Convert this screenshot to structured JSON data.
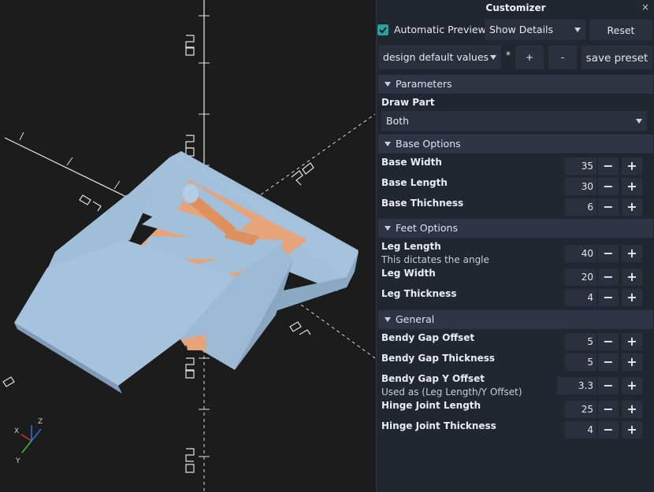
{
  "customizer": {
    "title": "Customizer",
    "close_label": "×",
    "automatic_preview_label": "Automatic Preview",
    "automatic_preview_checked": true,
    "details_select": "Show Details",
    "reset_label": "Reset",
    "preset_select": "design default values",
    "preset_modified_marker": "*",
    "add_preset_label": "+",
    "remove_preset_label": "-",
    "save_preset_label": "save preset"
  },
  "sections": {
    "parameters": {
      "label": "Parameters",
      "draw_part_label": "Draw Part",
      "draw_part_value": "Both"
    },
    "base_options": {
      "label": "Base Options",
      "base_width": {
        "label": "Base Width",
        "value": "35"
      },
      "base_length": {
        "label": "Base Length",
        "value": "30"
      },
      "base_thickness": {
        "label": "Base Thichness",
        "value": "6"
      }
    },
    "feet_options": {
      "label": "Feet Options",
      "leg_length": {
        "label": "Leg Length",
        "desc": "This dictates the angle",
        "value": "40"
      },
      "leg_width": {
        "label": "Leg Width",
        "value": "20"
      },
      "leg_thickness": {
        "label": "Leg Thickness",
        "value": "4"
      }
    },
    "general": {
      "label": "General",
      "bendy_gap_offset": {
        "label": "Bendy Gap Offset",
        "value": "5"
      },
      "bendy_gap_thickness": {
        "label": "Bendy Gap Thickness",
        "value": "5"
      },
      "bendy_gap_y_offset": {
        "label": "Bendy Gap Y Offset",
        "desc": "Used as (Leg Length/Y Offset)",
        "value": "3.3"
      },
      "hinge_joint_length": {
        "label": "Hinge Joint Length",
        "value": "25"
      },
      "hinge_joint_thickness": {
        "label": "Hinge Joint Thickness",
        "value": "4"
      }
    }
  },
  "stepper": {
    "minus": "−",
    "plus": "+"
  },
  "viewport": {
    "axis_labels": {
      "x": "X",
      "y": "Y",
      "z": "Z"
    },
    "colors": {
      "background": "#1c1c1c",
      "model_face": "#a6c2dc",
      "model_side": "#8aa8c4",
      "cutout": "#e7a37a",
      "axis_x": "#e03030",
      "axis_y": "#3cc040",
      "axis_z": "#3070e0"
    }
  }
}
